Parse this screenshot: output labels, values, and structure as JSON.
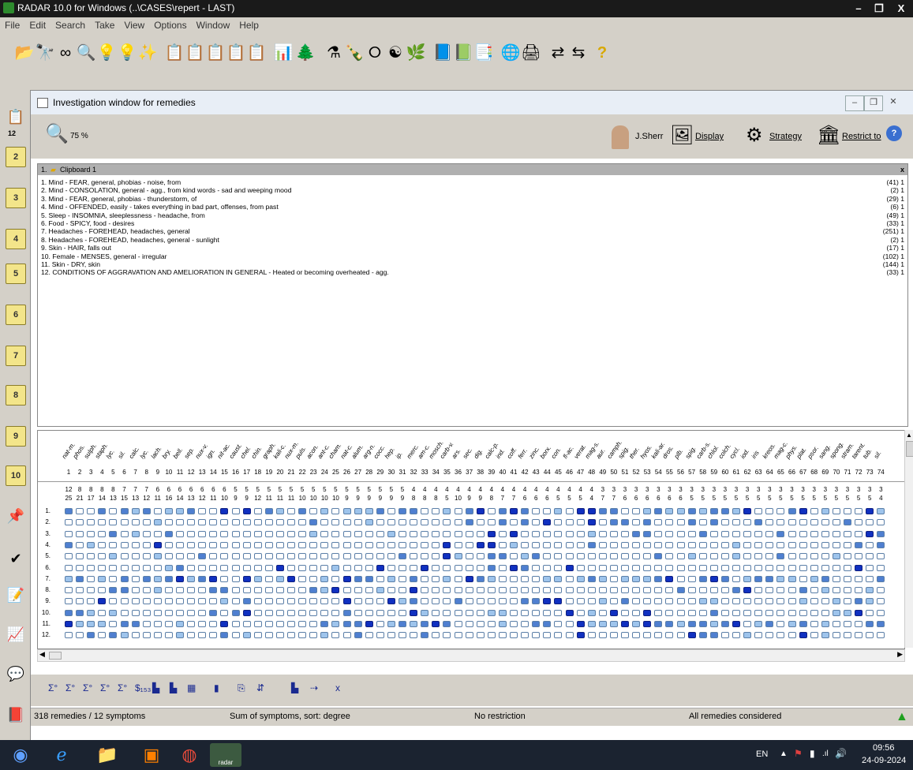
{
  "window": {
    "title": "RADAR 10.0 for Windows  (..\\CASES\\repert - LAST)",
    "min": "–",
    "max": "❐",
    "close": "X"
  },
  "menu": [
    "File",
    "Edit",
    "Search",
    "Take",
    "View",
    "Options",
    "Window",
    "Help"
  ],
  "leftbar": {
    "count": "12",
    "clipboards": [
      "2",
      "3",
      "4",
      "5",
      "6",
      "7",
      "8",
      "9",
      "10"
    ]
  },
  "child": {
    "title": "Investigation window for remedies",
    "zoom": "75 %",
    "user": "J.Sherr",
    "display": "Display",
    "strategy": "Strategy",
    "restrict": "Restrict to",
    "help": "?"
  },
  "clipboard": {
    "header": "Clipboard 1",
    "header_num": "1.",
    "close": "x",
    "symptoms": [
      {
        "text": "1. Mind - FEAR, general, phobias - noise, from",
        "count": "(41) 1"
      },
      {
        "text": "2. Mind - CONSOLATION, general - agg., from kind words - sad and weeping mood",
        "count": "(2) 1"
      },
      {
        "text": "3. Mind - FEAR, general, phobias - thunderstorm, of",
        "count": "(29) 1"
      },
      {
        "text": "4. Mind - OFFENDED, easily - takes everything in bad part, offenses, from past",
        "count": "(6) 1"
      },
      {
        "text": "5. Sleep - INSOMNIA, sleeplessness - headache, from",
        "count": "(49) 1"
      },
      {
        "text": "6. Food - SPICY, food - desires",
        "count": "(33) 1"
      },
      {
        "text": "7. Headaches - FOREHEAD, headaches, general",
        "count": "(251) 1"
      },
      {
        "text": "8. Headaches - FOREHEAD, headaches, general - sunlight",
        "count": "(2) 1"
      },
      {
        "text": "9. Skin - HAIR, falls out",
        "count": "(17) 1"
      },
      {
        "text": "10. Female - MENSES, general - irregular",
        "count": "(102) 1"
      },
      {
        "text": "11. Skin - DRY, skin",
        "count": "(144) 1"
      },
      {
        "text": "12. CONDITIONS OF AGGRAVATION AND AMELIORATION IN GENERAL - Heated or becoming overheated - agg.",
        "count": "(33) 1"
      }
    ]
  },
  "grid": {
    "remedies": [
      "nat-m.",
      "phos.",
      "sulph.",
      "staph.",
      "lyc.",
      "sil.",
      "calc.",
      "lyc.",
      "lach.",
      "bry.",
      "bell.",
      "sep.",
      "nux-v.",
      "ign.",
      "nit-ac.",
      "caust.",
      "chel.",
      "chin.",
      "graph.",
      "kali-c.",
      "nux-m.",
      "puls.",
      "acon.",
      "ant-c.",
      "cham.",
      "nat-c.",
      "alum.",
      "arg-n.",
      "cocc.",
      "hep.",
      "ip.",
      "merc.",
      "am-c.",
      "mosch.",
      "carb-v.",
      "ars.",
      "sec.",
      "dig.",
      "calc-p.",
      "ind.",
      "coff.",
      "ferr.",
      "zinc.",
      "borx.",
      "con.",
      "fl-ac.",
      "verat.",
      "mag-s.",
      "aur.",
      "camph.",
      "spig.",
      "ther.",
      "hyos.",
      "kali-ar.",
      "dros.",
      "plb.",
      "spig.",
      "carb-s.",
      "chlol.",
      "colch.",
      "cycl.",
      "iod.",
      "iris",
      "kreos.",
      "mag-c.",
      "phys.",
      "plat.",
      "psor.",
      "sang.",
      "spong.",
      "stram.",
      "tarent.",
      "tub.",
      "sil."
    ],
    "numbers": [
      "1",
      "2",
      "3",
      "4",
      "5",
      "6",
      "7",
      "8",
      "9",
      "10",
      "11",
      "12",
      "13",
      "14",
      "15",
      "16",
      "17",
      "18",
      "19",
      "20",
      "21",
      "22",
      "23",
      "24",
      "25",
      "26",
      "27",
      "28",
      "29",
      "30",
      "31",
      "32",
      "33",
      "34",
      "35",
      "36",
      "37",
      "38",
      "39",
      "40",
      "41",
      "42",
      "43",
      "44",
      "45",
      "46",
      "47",
      "48",
      "49",
      "50",
      "51",
      "52",
      "53",
      "54",
      "55",
      "56",
      "57",
      "58",
      "59",
      "60",
      "61",
      "62",
      "63",
      "64",
      "65",
      "66",
      "67",
      "68",
      "69",
      "70",
      "71",
      "72",
      "73",
      "74"
    ],
    "sym_counts": [
      "12",
      "8",
      "8",
      "8",
      "8",
      "7",
      "7",
      "7",
      "6",
      "6",
      "6",
      "6",
      "6",
      "6",
      "6",
      "5",
      "5",
      "5",
      "5",
      "5",
      "5",
      "5",
      "5",
      "5",
      "5",
      "5",
      "5",
      "5",
      "5",
      "5",
      "5",
      "4",
      "4",
      "4",
      "4",
      "4",
      "4",
      "4",
      "4",
      "4",
      "4",
      "4",
      "4",
      "4",
      "4",
      "4",
      "4",
      "4",
      "3",
      "3",
      "3",
      "3",
      "3",
      "3",
      "3",
      "3",
      "3",
      "3",
      "3",
      "3",
      "3",
      "3",
      "3",
      "3",
      "3",
      "3",
      "3",
      "3",
      "3",
      "3",
      "3",
      "3",
      "3",
      "3"
    ],
    "degrees": [
      "25",
      "21",
      "17",
      "14",
      "13",
      "15",
      "13",
      "12",
      "11",
      "16",
      "14",
      "13",
      "12",
      "11",
      "10",
      "9",
      "9",
      "12",
      "11",
      "11",
      "11",
      "10",
      "10",
      "10",
      "10",
      "9",
      "9",
      "9",
      "9",
      "9",
      "9",
      "8",
      "8",
      "8",
      "5",
      "10",
      "9",
      "9",
      "8",
      "7",
      "7",
      "6",
      "6",
      "6",
      "5",
      "5",
      "5",
      "4",
      "7",
      "7",
      "6",
      "6",
      "6",
      "6",
      "6",
      "6",
      "5",
      "5",
      "5",
      "5",
      "5",
      "5",
      "5",
      "5",
      "5",
      "5",
      "5",
      "5",
      "5",
      "5",
      "5",
      "5",
      "5",
      "4"
    ],
    "row_labels": [
      "1.",
      "2.",
      "3.",
      "4.",
      "5.",
      "6.",
      "7.",
      "8.",
      "9.",
      "10.",
      "11.",
      "12."
    ]
  },
  "bottom_tools": [
    "Σ°",
    "Σ°",
    "Σ°",
    "Σ°",
    "Σ°",
    "$₁₅₃",
    "▙",
    "▙",
    "▦",
    "▮",
    "⎘",
    "⇵",
    "▙",
    "⇢",
    "x"
  ],
  "status": {
    "left": "318 remedies / 12 symptoms",
    "sort": "Sum of symptoms, sort: degree",
    "restriction": "No restriction",
    "considered": "All remedies considered"
  },
  "taskbar": {
    "lang": "EN",
    "time": "09:56",
    "date": "24-09-2024",
    "radar_label": "radar"
  }
}
